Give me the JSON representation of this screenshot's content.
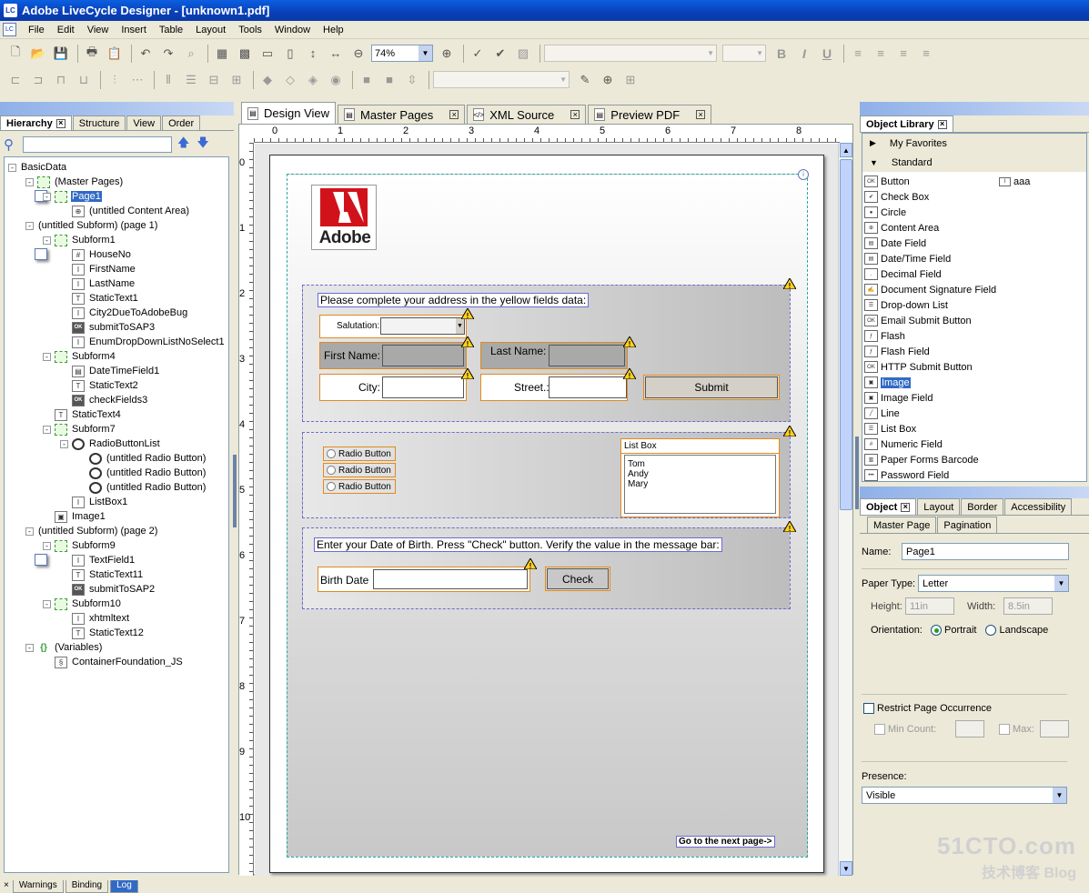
{
  "window": {
    "title": "Adobe LiveCycle Designer - [unknown1.pdf]",
    "app_icon": "LC"
  },
  "menu": [
    "File",
    "Edit",
    "View",
    "Insert",
    "Table",
    "Layout",
    "Tools",
    "Window",
    "Help"
  ],
  "toolbar": {
    "zoom": "74%"
  },
  "hierarchy": {
    "tabs": [
      "Hierarchy",
      "Structure",
      "View",
      "Order"
    ],
    "tree": [
      {
        "label": "BasicData",
        "level": 0,
        "icon": "page",
        "exp": "-"
      },
      {
        "label": "(Master Pages)",
        "level": 1,
        "icon": "sub",
        "exp": "-"
      },
      {
        "label": "Page1",
        "level": 2,
        "icon": "sub",
        "exp": "-",
        "selected": true
      },
      {
        "label": "(untitled Content Area)",
        "level": 3,
        "icon": "content",
        "exp": ""
      },
      {
        "label": "(untitled Subform) (page 1)",
        "level": 1,
        "icon": "page",
        "exp": "-"
      },
      {
        "label": "Subform1",
        "level": 2,
        "icon": "sub",
        "exp": "-"
      },
      {
        "label": "HouseNo",
        "level": 3,
        "icon": "num",
        "exp": ""
      },
      {
        "label": "FirstName",
        "level": 3,
        "icon": "text",
        "exp": ""
      },
      {
        "label": "LastName",
        "level": 3,
        "icon": "text",
        "exp": ""
      },
      {
        "label": "StaticText1",
        "level": 3,
        "icon": "static",
        "exp": ""
      },
      {
        "label": "City2DueToAdobeBug",
        "level": 3,
        "icon": "text",
        "exp": ""
      },
      {
        "label": "submitToSAP3",
        "level": 3,
        "icon": "ok",
        "exp": ""
      },
      {
        "label": "EnumDropDownListNoSelect1",
        "level": 3,
        "icon": "text",
        "exp": ""
      },
      {
        "label": "Subform4",
        "level": 2,
        "icon": "sub",
        "exp": "-"
      },
      {
        "label": "DateTimeField1",
        "level": 3,
        "icon": "date",
        "exp": ""
      },
      {
        "label": "StaticText2",
        "level": 3,
        "icon": "static",
        "exp": ""
      },
      {
        "label": "checkFields3",
        "level": 3,
        "icon": "ok",
        "exp": ""
      },
      {
        "label": "StaticText4",
        "level": 2,
        "icon": "static",
        "exp": ""
      },
      {
        "label": "Subform7",
        "level": 2,
        "icon": "sub",
        "exp": "-"
      },
      {
        "label": "RadioButtonList",
        "level": 3,
        "icon": "radio",
        "exp": "-"
      },
      {
        "label": "(untitled Radio Button)",
        "level": 4,
        "icon": "radio",
        "exp": ""
      },
      {
        "label": "(untitled Radio Button)",
        "level": 4,
        "icon": "radio",
        "exp": ""
      },
      {
        "label": "(untitled Radio Button)",
        "level": 4,
        "icon": "radio",
        "exp": ""
      },
      {
        "label": "ListBox1",
        "level": 3,
        "icon": "text",
        "exp": ""
      },
      {
        "label": "Image1",
        "level": 2,
        "icon": "image",
        "exp": ""
      },
      {
        "label": "(untitled Subform) (page 2)",
        "level": 1,
        "icon": "page",
        "exp": "-"
      },
      {
        "label": "Subform9",
        "level": 2,
        "icon": "sub",
        "exp": "-"
      },
      {
        "label": "TextField1",
        "level": 3,
        "icon": "text",
        "exp": ""
      },
      {
        "label": "StaticText11",
        "level": 3,
        "icon": "static",
        "exp": ""
      },
      {
        "label": "submitToSAP2",
        "level": 3,
        "icon": "ok",
        "exp": ""
      },
      {
        "label": "Subform10",
        "level": 2,
        "icon": "sub",
        "exp": "-"
      },
      {
        "label": "xhtmltext",
        "level": 3,
        "icon": "text",
        "exp": ""
      },
      {
        "label": "StaticText12",
        "level": 3,
        "icon": "static",
        "exp": ""
      },
      {
        "label": "(Variables)",
        "level": 1,
        "icon": "var",
        "exp": "-"
      },
      {
        "label": "ContainerFoundation_JS",
        "level": 2,
        "icon": "script",
        "exp": ""
      }
    ]
  },
  "doc_tabs": [
    {
      "label": "Design View",
      "active": true,
      "closable": false
    },
    {
      "label": "Master Pages",
      "active": false,
      "closable": true
    },
    {
      "label": "XML Source",
      "active": false,
      "closable": true
    },
    {
      "label": "Preview PDF",
      "active": false,
      "closable": true
    }
  ],
  "rulers": {
    "top": [
      "0",
      "1",
      "2",
      "3",
      "4",
      "5",
      "6",
      "7",
      "8"
    ],
    "left": [
      "0",
      "1",
      "2",
      "3",
      "4",
      "5",
      "6",
      "7",
      "8",
      "9",
      "10"
    ]
  },
  "form": {
    "logo_text": "Adobe",
    "address_heading": "Please complete your address  in the yellow fields data:",
    "salutation_label": "Salutation:",
    "first_name_label": "First Name:",
    "last_name_label": "Last Name:",
    "city_label": "City:",
    "street_label": "Street.:",
    "submit_label": "Submit",
    "radio_labels": [
      "Radio Button",
      "Radio Button",
      "Radio Button"
    ],
    "list_box_caption": "List Box",
    "list_items": [
      "Tom",
      "Andy",
      "Mary"
    ],
    "dob_heading": "Enter your Date of Birth. Press \"Check\" button. Verify the value in the message bar:",
    "birth_date_label": "Birth Date",
    "check_label": "Check",
    "next_page_link": "Go to the next page->"
  },
  "object_library": {
    "title": "Object Library",
    "categories": [
      "My Favorites",
      "Standard"
    ],
    "items": [
      {
        "label": "Button",
        "icon": "OK"
      },
      {
        "label": "Check Box",
        "icon": "check"
      },
      {
        "label": "Circle",
        "icon": "circle"
      },
      {
        "label": "Content Area",
        "icon": "content"
      },
      {
        "label": "Date Field",
        "icon": "date"
      },
      {
        "label": "Date/Time Field",
        "icon": "date"
      },
      {
        "label": "Decimal Field",
        "icon": "dec"
      },
      {
        "label": "Document Signature Field",
        "icon": "sig"
      },
      {
        "label": "Drop-down List",
        "icon": "list"
      },
      {
        "label": "Email Submit Button",
        "icon": "OK"
      },
      {
        "label": "Flash",
        "icon": "flash"
      },
      {
        "label": "Flash Field",
        "icon": "flash"
      },
      {
        "label": "HTTP Submit Button",
        "icon": "OK"
      },
      {
        "label": "Image",
        "icon": "image",
        "selected": true
      },
      {
        "label": "Image Field",
        "icon": "image"
      },
      {
        "label": "Line",
        "icon": "line"
      },
      {
        "label": "List Box",
        "icon": "list"
      },
      {
        "label": "Numeric Field",
        "icon": "num"
      },
      {
        "label": "Paper Forms Barcode",
        "icon": "barcode"
      },
      {
        "label": "Password Field",
        "icon": "pwd"
      }
    ],
    "favorite_item": "aaa"
  },
  "object_props": {
    "tabs": [
      "Object",
      "Layout",
      "Border",
      "Accessibility"
    ],
    "subtabs": [
      "Master Page",
      "Pagination"
    ],
    "name_label": "Name:",
    "name_value": "Page1",
    "paper_type_label": "Paper Type:",
    "paper_type_value": "Letter",
    "height_label": "Height:",
    "height_value": "11in",
    "width_label": "Width:",
    "width_value": "8.5in",
    "orientation_label": "Orientation:",
    "portrait_label": "Portrait",
    "landscape_label": "Landscape",
    "restrict_label": "Restrict Page Occurrence",
    "min_count_label": "Min Count:",
    "max_label": "Max:",
    "presence_label": "Presence:",
    "presence_value": "Visible"
  },
  "bottom_tabs": [
    "Warnings",
    "Binding",
    "Log"
  ],
  "watermark": {
    "line1": "51CTO.com",
    "line2": "技术博客  Blog"
  }
}
